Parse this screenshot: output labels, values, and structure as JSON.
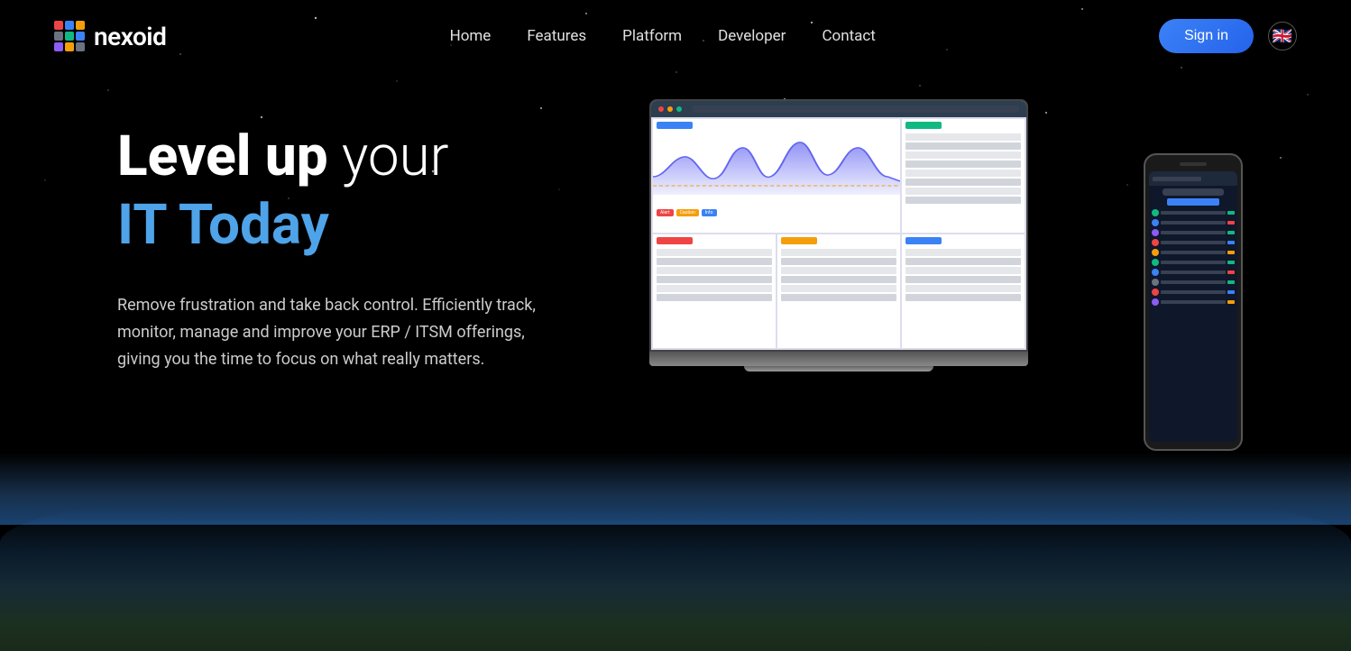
{
  "nav": {
    "logo_text": "nexoid",
    "links": [
      {
        "id": "home",
        "label": "Home"
      },
      {
        "id": "features",
        "label": "Features"
      },
      {
        "id": "platform",
        "label": "Platform"
      },
      {
        "id": "developer",
        "label": "Developer"
      },
      {
        "id": "contact",
        "label": "Contact"
      }
    ],
    "sign_in_label": "Sign in",
    "lang_emoji": "🇬🇧"
  },
  "hero": {
    "title_bold": "Level up",
    "title_light": " your",
    "title_blue": "IT Today",
    "description": "Remove frustration and take back control. Efficiently track, monitor, manage and improve your ERP / ITSM offerings, giving you the time to focus on what really matters."
  },
  "logo_dots": [
    {
      "color": "#ef4444"
    },
    {
      "color": "#3b82f6"
    },
    {
      "color": "#f59e0b"
    },
    {
      "color": "#6b7280"
    },
    {
      "color": "#10b981"
    },
    {
      "color": "#3b82f6"
    },
    {
      "color": "#8b5cf6"
    },
    {
      "color": "#f59e0b"
    },
    {
      "color": "#6b7280"
    }
  ]
}
